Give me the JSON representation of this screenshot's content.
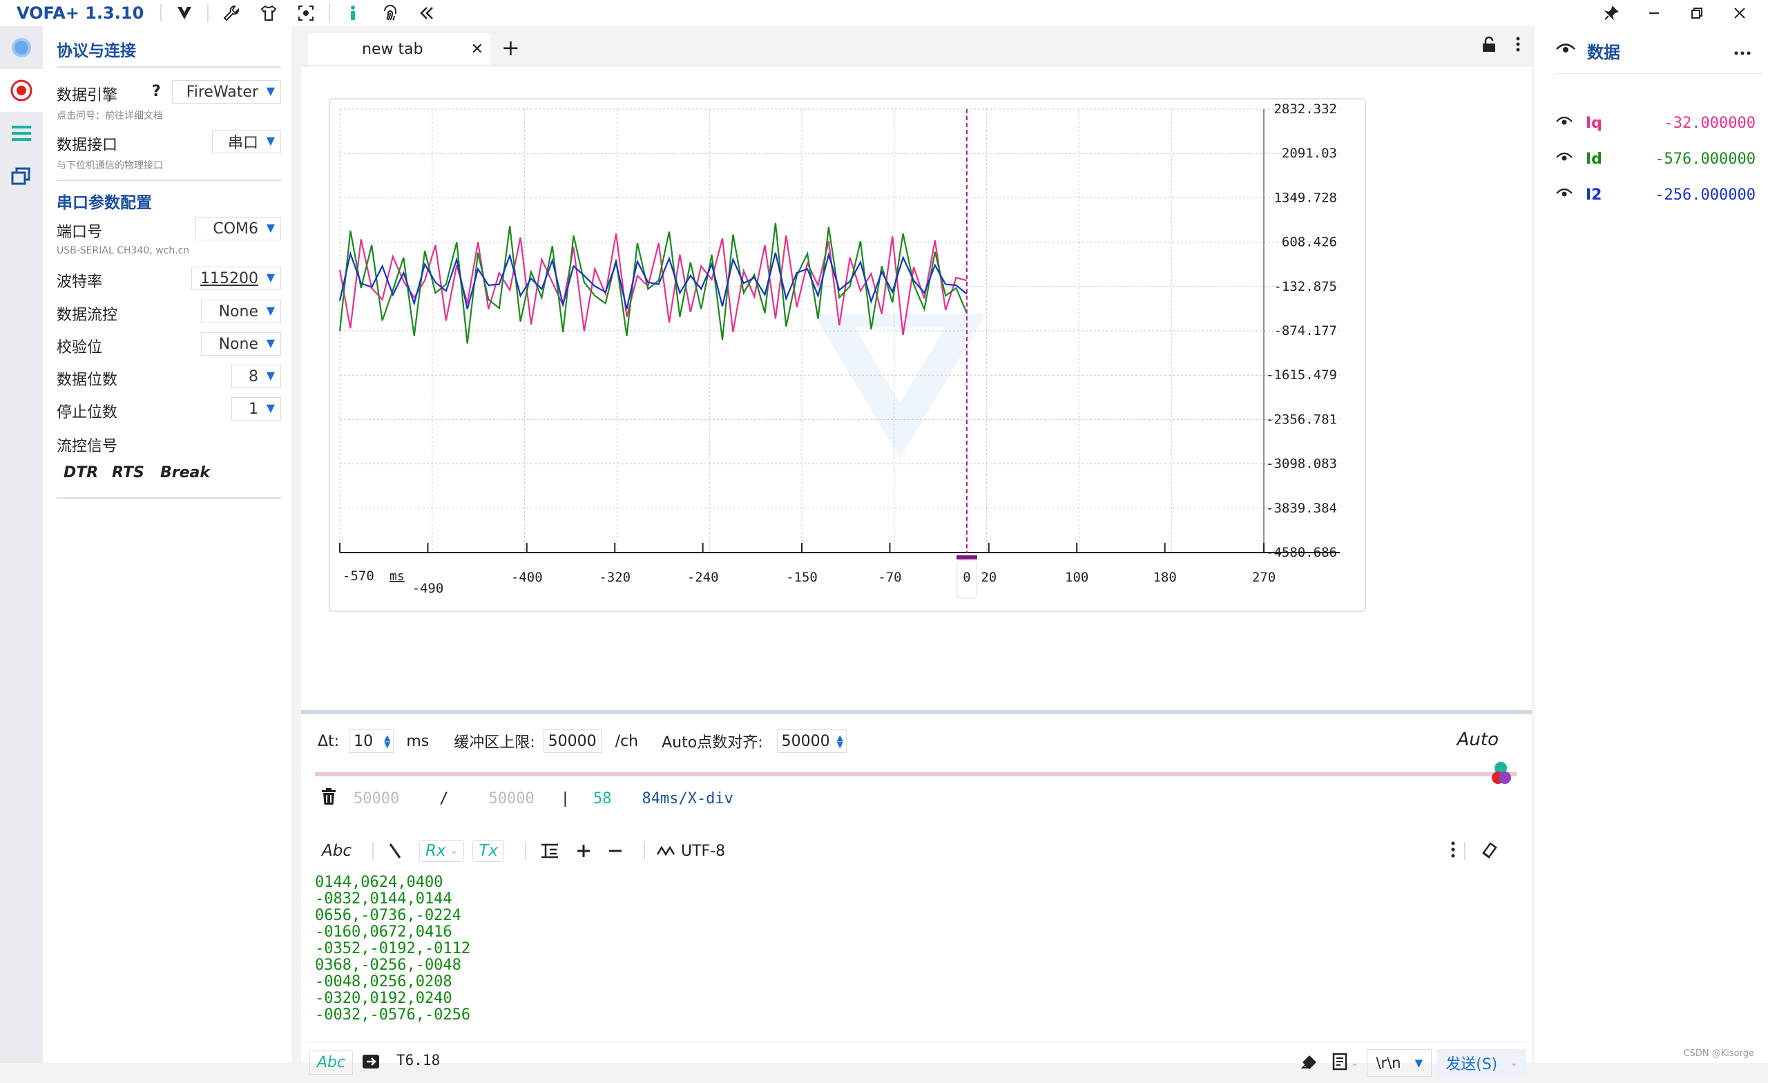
{
  "app": {
    "title": "VOFA+ 1.3.10"
  },
  "colors": {
    "accent": "#1a4fa0",
    "iq": "#e8308c",
    "id": "#1a8a1a",
    "i2": "#1535c8",
    "rx_text": "#0c8a0c",
    "teal": "#19b5a0"
  },
  "titlebar_icons": [
    "vofa-logo-icon",
    "wrench-icon",
    "shirt-icon",
    "capture-icon",
    "info-icon",
    "fingerprint-icon",
    "collapse-icon"
  ],
  "connection": {
    "title": "协议与连接",
    "engine_label": "数据引擎",
    "engine_help": "?",
    "engine_value": "FireWater",
    "engine_hint": "点击问号：前往详细文档",
    "interface_label": "数据接口",
    "interface_value": "串口",
    "interface_hint": "与下位机通信的物理接口",
    "serial_title": "串口参数配置",
    "port_label": "端口号",
    "port_value": "COM6",
    "port_hint": "USB-SERIAL CH340, wch.cn",
    "baud_label": "波特率",
    "baud_value": "115200",
    "flow_label": "数据流控",
    "flow_value": "None",
    "parity_label": "校验位",
    "parity_value": "None",
    "databits_label": "数据位数",
    "databits_value": "8",
    "stopbits_label": "停止位数",
    "stopbits_value": "1",
    "signal_label": "流控信号",
    "dtr": "DTR",
    "rts": "RTS",
    "break": "Break"
  },
  "tab": {
    "title": "new tab",
    "close": "✕",
    "add": "+"
  },
  "chart_data": {
    "type": "line",
    "xlabel": "ms",
    "x_ticks": [
      "-570",
      "-490",
      "-400",
      "-320",
      "-240",
      "-150",
      "-70",
      "0",
      "20",
      "100",
      "180",
      "270"
    ],
    "y_ticks": [
      "2832.332",
      "2091.03",
      "1349.728",
      "608.426",
      "-132.875",
      "-874.177",
      "-1615.479",
      "-2356.781",
      "-3098.083",
      "-3839.384",
      "-4580.686"
    ],
    "ylim": [
      -4580.686,
      2832.332
    ],
    "xlim": [
      -570,
      270
    ],
    "cursor_x": 0,
    "grid": true,
    "series": [
      {
        "name": "Iq",
        "color": "#e8308c",
        "values": [
          144,
          -832,
          656,
          -160,
          -352,
          368,
          -48,
          -320,
          -32,
          560,
          -704,
          224,
          -416,
          608,
          -512,
          96,
          -192,
          688,
          -768,
          320,
          -64,
          -448,
          528,
          -880,
          160,
          -256,
          752,
          -640,
          48,
          -128,
          592,
          -736,
          400,
          -560,
          208,
          -16,
          672,
          -896,
          128,
          -304,
          560,
          -672,
          720,
          -480,
          256,
          -112,
          624,
          -784,
          352,
          -208,
          80,
          -592,
          704,
          -944,
          192,
          -336,
          640,
          -528,
          16,
          -32
        ]
      },
      {
        "name": "Id",
        "color": "#1a8a1a",
        "values": [
          -880,
          800,
          -160,
          560,
          -704,
          -192,
          352,
          -960,
          464,
          -240,
          -96,
          608,
          -1088,
          432,
          -352,
          -496,
          880,
          -720,
          112,
          -320,
          544,
          -896,
          720,
          -64,
          -288,
          -416,
          320,
          -960,
          592,
          -176,
          -32,
          784,
          -640,
          272,
          -512,
          400,
          -1024,
          736,
          -240,
          64,
          -576,
          928,
          -800,
          48,
          416,
          -672,
          864,
          -320,
          -128,
          624,
          -848,
          208,
          -400,
          752,
          -96,
          -512,
          448,
          -288,
          -160,
          -576
        ]
      },
      {
        "name": "I2",
        "color": "#1535c8",
        "values": [
          -368,
          416,
          -80,
          -144,
          208,
          -272,
          96,
          -416,
          240,
          -64,
          -208,
          320,
          -512,
          160,
          -112,
          -96,
          384,
          -288,
          0,
          -176,
          304,
          -432,
          208,
          48,
          -128,
          -224,
          256,
          -512,
          288,
          -64,
          -96,
          336,
          -240,
          48,
          -176,
          240,
          -464,
          320,
          -80,
          16,
          -272,
          432,
          -336,
          96,
          160,
          -288,
          400,
          -192,
          -48,
          272,
          -384,
          112,
          -224,
          352,
          -32,
          -240,
          224,
          -96,
          -112,
          -256
        ]
      }
    ]
  },
  "controls": {
    "dt_label": "Δt:",
    "dt_value": "10",
    "dt_unit": "ms",
    "buf_label": "缓冲区上限:",
    "buf_value": "50000",
    "buf_unit": "/ch",
    "auto_label": "Auto点数对齐:",
    "auto_value": "50000",
    "auto_btn": "Auto"
  },
  "stats": {
    "count1": "50000",
    "sep1": "/",
    "count2": "50000",
    "sep2": "|",
    "fps": "58",
    "xdiv": "84ms/X-div"
  },
  "slider": {
    "position": 0.99
  },
  "rx_toolbar": {
    "abc": "Abc",
    "rx": "Rx",
    "tx": "Tx",
    "encoding": "UTF-8"
  },
  "rx_lines": [
    "0144,0624,0400",
    "-0832,0144,0144",
    "0656,-0736,-0224",
    "-0160,0672,0416",
    "-0352,-0192,-0112",
    "0368,-0256,-0048",
    "-0048,0256,0208",
    "-0320,0192,0240",
    "-0032,-0576,-0256"
  ],
  "send": {
    "abc": "Abc",
    "input": "T6.18",
    "eol": "\\r\\n",
    "send_label": "发送(S)"
  },
  "data_panel": {
    "title": "数据",
    "channels": [
      {
        "name": "Iq",
        "value": "-32.000000",
        "color": "#e8308c"
      },
      {
        "name": "Id",
        "value": "-576.000000",
        "color": "#1a8a1a"
      },
      {
        "name": "I2",
        "value": "-256.000000",
        "color": "#1535c8"
      }
    ]
  },
  "watermark": "CSDN @Kisorge"
}
